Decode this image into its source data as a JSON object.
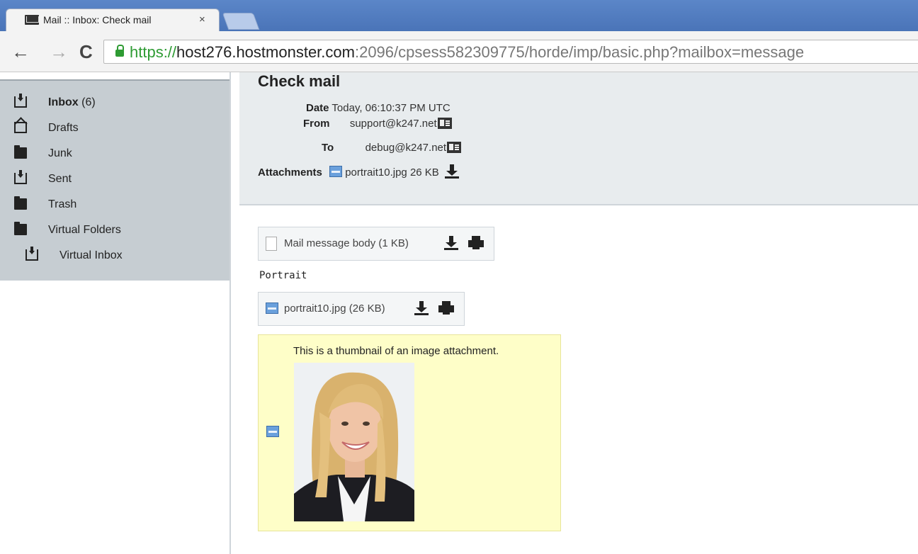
{
  "browser": {
    "tab_title": "Mail :: Inbox: Check mail",
    "tab_close": "×",
    "url_proto": "https://",
    "url_host": "host276.hostmonster.com",
    "url_rest": ":2096/cpsess582309775/horde/imp/basic.php?mailbox=message",
    "nav_back": "←",
    "nav_forward": "→",
    "nav_reload": "C"
  },
  "sidebar": {
    "folders": [
      {
        "label": "Inbox",
        "count": "(6)",
        "icon": "inbox-icon"
      },
      {
        "label": "Drafts",
        "icon": "drafts-icon"
      },
      {
        "label": "Junk",
        "icon": "folder-icon"
      },
      {
        "label": "Sent",
        "icon": "inbox-icon"
      },
      {
        "label": "Trash",
        "icon": "folder-icon"
      },
      {
        "label": "Virtual Folders",
        "icon": "folder-icon"
      },
      {
        "label": "Virtual Inbox",
        "icon": "inbox-icon"
      }
    ]
  },
  "message": {
    "title": "Check mail",
    "date_label": "Date",
    "date_value": "Today, 06:10:37 PM UTC",
    "from_label": "From",
    "from_value": "support@k247.net",
    "to_label": "To",
    "to_value": "debug@k247.net",
    "attachments_label": "Attachments",
    "attachment_name": "portrait10.jpg",
    "attachment_size": "26 KB"
  },
  "body": {
    "part1_label": "Mail message body (1 KB)",
    "text": "Portrait",
    "part2_label": "portrait10.jpg (26 KB)",
    "thumbnail_caption": "This is a thumbnail of an image attachment."
  }
}
